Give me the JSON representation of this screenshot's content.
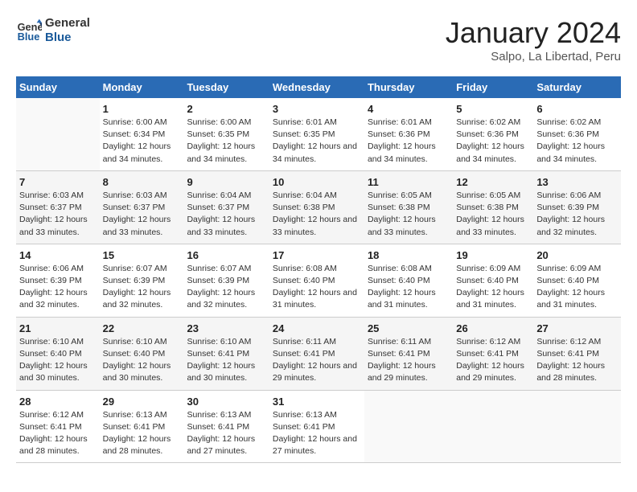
{
  "logo": {
    "line1": "General",
    "line2": "Blue"
  },
  "title": "January 2024",
  "location": "Salpo, La Libertad, Peru",
  "header_days": [
    "Sunday",
    "Monday",
    "Tuesday",
    "Wednesday",
    "Thursday",
    "Friday",
    "Saturday"
  ],
  "weeks": [
    [
      {
        "day": "",
        "sunrise": "",
        "sunset": "",
        "daylight": ""
      },
      {
        "day": "1",
        "sunrise": "Sunrise: 6:00 AM",
        "sunset": "Sunset: 6:34 PM",
        "daylight": "Daylight: 12 hours and 34 minutes."
      },
      {
        "day": "2",
        "sunrise": "Sunrise: 6:00 AM",
        "sunset": "Sunset: 6:35 PM",
        "daylight": "Daylight: 12 hours and 34 minutes."
      },
      {
        "day": "3",
        "sunrise": "Sunrise: 6:01 AM",
        "sunset": "Sunset: 6:35 PM",
        "daylight": "Daylight: 12 hours and 34 minutes."
      },
      {
        "day": "4",
        "sunrise": "Sunrise: 6:01 AM",
        "sunset": "Sunset: 6:36 PM",
        "daylight": "Daylight: 12 hours and 34 minutes."
      },
      {
        "day": "5",
        "sunrise": "Sunrise: 6:02 AM",
        "sunset": "Sunset: 6:36 PM",
        "daylight": "Daylight: 12 hours and 34 minutes."
      },
      {
        "day": "6",
        "sunrise": "Sunrise: 6:02 AM",
        "sunset": "Sunset: 6:36 PM",
        "daylight": "Daylight: 12 hours and 34 minutes."
      }
    ],
    [
      {
        "day": "7",
        "sunrise": "Sunrise: 6:03 AM",
        "sunset": "Sunset: 6:37 PM",
        "daylight": "Daylight: 12 hours and 33 minutes."
      },
      {
        "day": "8",
        "sunrise": "Sunrise: 6:03 AM",
        "sunset": "Sunset: 6:37 PM",
        "daylight": "Daylight: 12 hours and 33 minutes."
      },
      {
        "day": "9",
        "sunrise": "Sunrise: 6:04 AM",
        "sunset": "Sunset: 6:37 PM",
        "daylight": "Daylight: 12 hours and 33 minutes."
      },
      {
        "day": "10",
        "sunrise": "Sunrise: 6:04 AM",
        "sunset": "Sunset: 6:38 PM",
        "daylight": "Daylight: 12 hours and 33 minutes."
      },
      {
        "day": "11",
        "sunrise": "Sunrise: 6:05 AM",
        "sunset": "Sunset: 6:38 PM",
        "daylight": "Daylight: 12 hours and 33 minutes."
      },
      {
        "day": "12",
        "sunrise": "Sunrise: 6:05 AM",
        "sunset": "Sunset: 6:38 PM",
        "daylight": "Daylight: 12 hours and 33 minutes."
      },
      {
        "day": "13",
        "sunrise": "Sunrise: 6:06 AM",
        "sunset": "Sunset: 6:39 PM",
        "daylight": "Daylight: 12 hours and 32 minutes."
      }
    ],
    [
      {
        "day": "14",
        "sunrise": "Sunrise: 6:06 AM",
        "sunset": "Sunset: 6:39 PM",
        "daylight": "Daylight: 12 hours and 32 minutes."
      },
      {
        "day": "15",
        "sunrise": "Sunrise: 6:07 AM",
        "sunset": "Sunset: 6:39 PM",
        "daylight": "Daylight: 12 hours and 32 minutes."
      },
      {
        "day": "16",
        "sunrise": "Sunrise: 6:07 AM",
        "sunset": "Sunset: 6:39 PM",
        "daylight": "Daylight: 12 hours and 32 minutes."
      },
      {
        "day": "17",
        "sunrise": "Sunrise: 6:08 AM",
        "sunset": "Sunset: 6:40 PM",
        "daylight": "Daylight: 12 hours and 31 minutes."
      },
      {
        "day": "18",
        "sunrise": "Sunrise: 6:08 AM",
        "sunset": "Sunset: 6:40 PM",
        "daylight": "Daylight: 12 hours and 31 minutes."
      },
      {
        "day": "19",
        "sunrise": "Sunrise: 6:09 AM",
        "sunset": "Sunset: 6:40 PM",
        "daylight": "Daylight: 12 hours and 31 minutes."
      },
      {
        "day": "20",
        "sunrise": "Sunrise: 6:09 AM",
        "sunset": "Sunset: 6:40 PM",
        "daylight": "Daylight: 12 hours and 31 minutes."
      }
    ],
    [
      {
        "day": "21",
        "sunrise": "Sunrise: 6:10 AM",
        "sunset": "Sunset: 6:40 PM",
        "daylight": "Daylight: 12 hours and 30 minutes."
      },
      {
        "day": "22",
        "sunrise": "Sunrise: 6:10 AM",
        "sunset": "Sunset: 6:40 PM",
        "daylight": "Daylight: 12 hours and 30 minutes."
      },
      {
        "day": "23",
        "sunrise": "Sunrise: 6:10 AM",
        "sunset": "Sunset: 6:41 PM",
        "daylight": "Daylight: 12 hours and 30 minutes."
      },
      {
        "day": "24",
        "sunrise": "Sunrise: 6:11 AM",
        "sunset": "Sunset: 6:41 PM",
        "daylight": "Daylight: 12 hours and 29 minutes."
      },
      {
        "day": "25",
        "sunrise": "Sunrise: 6:11 AM",
        "sunset": "Sunset: 6:41 PM",
        "daylight": "Daylight: 12 hours and 29 minutes."
      },
      {
        "day": "26",
        "sunrise": "Sunrise: 6:12 AM",
        "sunset": "Sunset: 6:41 PM",
        "daylight": "Daylight: 12 hours and 29 minutes."
      },
      {
        "day": "27",
        "sunrise": "Sunrise: 6:12 AM",
        "sunset": "Sunset: 6:41 PM",
        "daylight": "Daylight: 12 hours and 28 minutes."
      }
    ],
    [
      {
        "day": "28",
        "sunrise": "Sunrise: 6:12 AM",
        "sunset": "Sunset: 6:41 PM",
        "daylight": "Daylight: 12 hours and 28 minutes."
      },
      {
        "day": "29",
        "sunrise": "Sunrise: 6:13 AM",
        "sunset": "Sunset: 6:41 PM",
        "daylight": "Daylight: 12 hours and 28 minutes."
      },
      {
        "day": "30",
        "sunrise": "Sunrise: 6:13 AM",
        "sunset": "Sunset: 6:41 PM",
        "daylight": "Daylight: 12 hours and 27 minutes."
      },
      {
        "day": "31",
        "sunrise": "Sunrise: 6:13 AM",
        "sunset": "Sunset: 6:41 PM",
        "daylight": "Daylight: 12 hours and 27 minutes."
      },
      {
        "day": "",
        "sunrise": "",
        "sunset": "",
        "daylight": ""
      },
      {
        "day": "",
        "sunrise": "",
        "sunset": "",
        "daylight": ""
      },
      {
        "day": "",
        "sunrise": "",
        "sunset": "",
        "daylight": ""
      }
    ]
  ]
}
